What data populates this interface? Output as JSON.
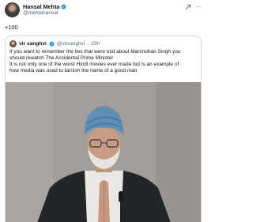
{
  "post": {
    "author_name": "Hansal Mehta",
    "author_handle": "@mehtahansal",
    "text": "+100",
    "more_label": "···"
  },
  "quoted_post": {
    "author_name": "vir sanghvi",
    "author_handle": "@virsanghvi",
    "time": "23h",
    "separator": "·",
    "lines": [
      "If you want to remember the lies that were told about Manmohan Singh you",
      "should rewatch The Accidental Prime Minister",
      "It is not only one of the worst Hindi movies ever made but is an example of",
      "how media was used to tarnish the name of a good man"
    ]
  },
  "colors": {
    "verified": "#1d9bf0",
    "text_primary": "#0f1419",
    "text_secondary": "#536471",
    "border": "#cfd9de",
    "turban": "#5f8fb6"
  },
  "icons": {
    "verified": "verified-badge-icon",
    "grok": "grok-icon",
    "more": "more-options-icon"
  }
}
